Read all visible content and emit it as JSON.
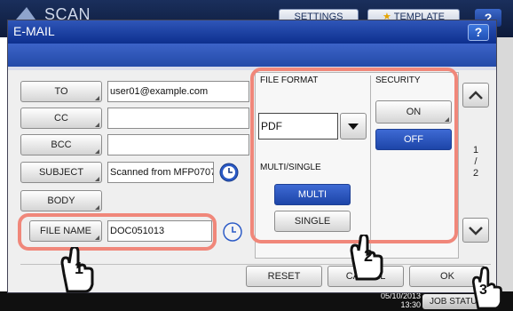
{
  "app": {
    "title": "SCAN",
    "settings_label": "SETTINGS",
    "template_label": "TEMPLATE",
    "help_label": "?"
  },
  "dialog": {
    "title": "E-MAIL",
    "help_label": "?"
  },
  "fields": {
    "to": {
      "label": "TO",
      "value": "user01@example.com"
    },
    "cc": {
      "label": "CC",
      "value": ""
    },
    "bcc": {
      "label": "BCC",
      "value": ""
    },
    "subject": {
      "label": "SUBJECT",
      "value": "Scanned from MFP0707"
    },
    "body": {
      "label": "BODY"
    },
    "file_name": {
      "label": "FILE NAME",
      "value": "DOC051013"
    }
  },
  "file_format": {
    "heading": "FILE FORMAT",
    "selected": "PDF"
  },
  "multi_single": {
    "heading": "MULTI/SINGLE",
    "multi_label": "MULTI",
    "single_label": "SINGLE",
    "selected": "MULTI"
  },
  "security": {
    "heading": "SECURITY",
    "on_label": "ON",
    "off_label": "OFF",
    "selected": "OFF"
  },
  "pager": {
    "current": "1",
    "sep": "/",
    "total": "2"
  },
  "actions": {
    "reset_label": "RESET",
    "cancel_label": "CANCEL",
    "ok_label": "OK"
  },
  "status_bar": {
    "date": "05/10/2013",
    "time": "13:30",
    "job_status_label": "JOB STATUS"
  },
  "callouts": [
    "1",
    "2",
    "3"
  ],
  "colors": {
    "dialog_title": "#1f43a8",
    "selected_blue": "#2a52c0",
    "callout": "#f0877a"
  }
}
